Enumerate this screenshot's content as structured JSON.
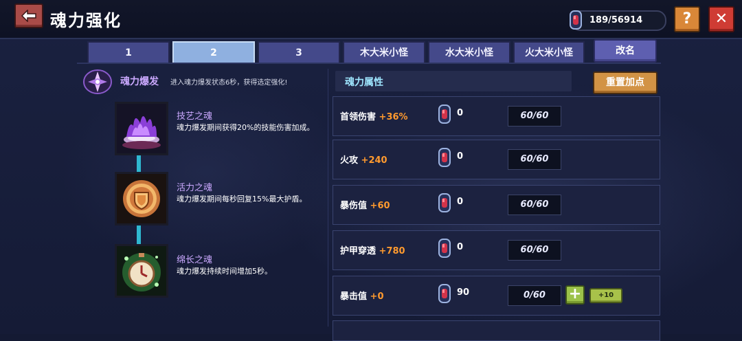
{
  "header": {
    "title": "魂力强化",
    "currency_amount": "189/56914",
    "help_label": "?",
    "close_label": "✕"
  },
  "tabs": [
    {
      "label": "1",
      "active": false
    },
    {
      "label": "2",
      "active": true
    },
    {
      "label": "3",
      "active": false
    },
    {
      "label": "木大米小怪",
      "active": false
    },
    {
      "label": "水大米小怪",
      "active": false
    },
    {
      "label": "火大米小怪",
      "active": false
    }
  ],
  "rename_label": "改名",
  "burst": {
    "label": "魂力爆发",
    "description": "进入魂力爆发状态6秒，获得选定强化!"
  },
  "souls": [
    {
      "name": "技艺之魂",
      "description": "魂力爆发期间获得20%的技能伤害加成。",
      "icon": "purple-flame-icon"
    },
    {
      "name": "活力之魂",
      "description": "魂力爆发期间每秒回复15%最大护盾。",
      "icon": "shield-icon"
    },
    {
      "name": "绵长之魂",
      "description": "魂力爆发持续时间增加5秒。",
      "icon": "stopwatch-icon"
    }
  ],
  "attributes_header": "魂力属性",
  "reset_label": "重置加点",
  "attributes": [
    {
      "name": "首领伤害",
      "bonus": "+36%",
      "cost": "0",
      "level": "60/60"
    },
    {
      "name": "火攻",
      "bonus": "+240",
      "cost": "0",
      "level": "60/60"
    },
    {
      "name": "暴伤值",
      "bonus": "+60",
      "cost": "0",
      "level": "60/60"
    },
    {
      "name": "护甲穿透",
      "bonus": "+780",
      "cost": "0",
      "level": "60/60"
    },
    {
      "name": "暴击值",
      "bonus": "+0",
      "cost": "90",
      "level": "0/60"
    }
  ],
  "plus_label": "+",
  "plus10_label": "+10",
  "colors": {
    "bonus": "#ff9a2e",
    "soul_name": "#cba9ff",
    "header_text": "#9fe6ff",
    "tab_active": "#8fb0e0",
    "tab_inactive": "#44498a"
  }
}
